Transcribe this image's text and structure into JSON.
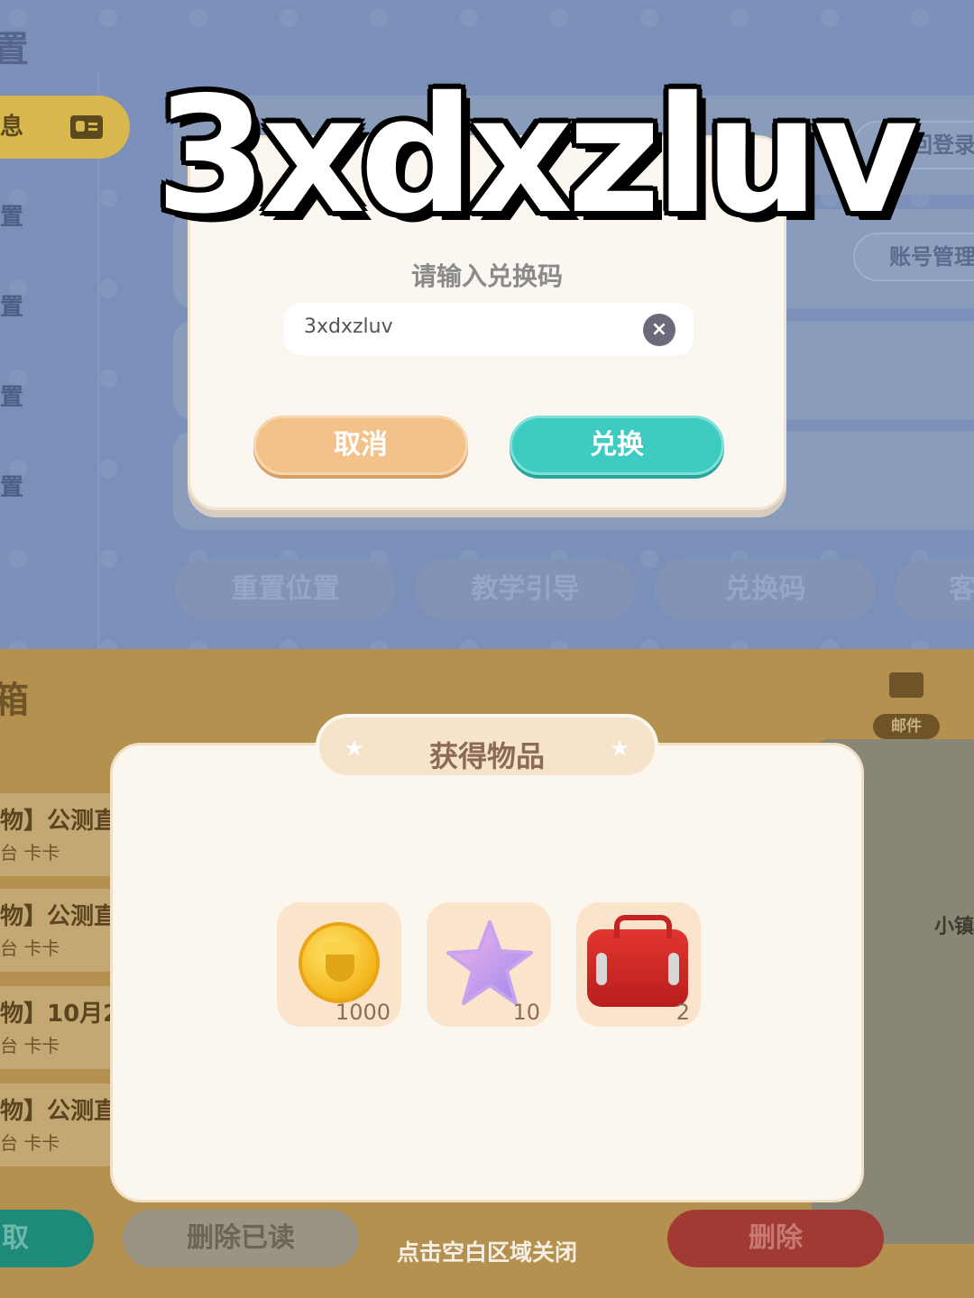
{
  "top_screen": {
    "title_fragment": "置",
    "sidebar": [
      {
        "label": "息",
        "active": true
      },
      {
        "label": "置"
      },
      {
        "label": "置"
      },
      {
        "label": "置"
      },
      {
        "label": "置"
      }
    ],
    "side_buttons": {
      "back_login": "返回登录",
      "account_manage": "账号管理"
    },
    "bottom_buttons": [
      {
        "label": "重置位置"
      },
      {
        "label": "教学引导"
      },
      {
        "label": "兑换码"
      },
      {
        "label": "客"
      }
    ]
  },
  "redeem_dialog": {
    "prompt": "请输入兑换码",
    "code_value": "3xdxzluv",
    "cancel_label": "取消",
    "exchange_label": "兑换"
  },
  "overlay_caption": "3xdxzluv",
  "mail_screen": {
    "title_fragment": "箱",
    "mail_label": "邮件",
    "items": [
      {
        "line1": "物】公测直",
        "line2": "台 卡卡"
      },
      {
        "line1": "物】公测直",
        "line2": "台 卡卡"
      },
      {
        "line1": "物】10月2",
        "line2": "台 卡卡"
      },
      {
        "line1": "物】公测直",
        "line2": "台 卡卡"
      }
    ],
    "right_fragment": "小镇",
    "claim_label": "取",
    "delete_read_label": "删除已读",
    "delete_label": "删除",
    "close_hint": "点击空白区域关闭"
  },
  "reward_dialog": {
    "title": "获得物品",
    "items": [
      {
        "icon": "acorn-coin-icon",
        "count": "1000"
      },
      {
        "icon": "star-icon",
        "count": "10"
      },
      {
        "icon": "red-toolbox-icon",
        "count": "2"
      }
    ]
  },
  "colors": {
    "cancel": "#f2c28a",
    "exchange": "#3ecbc1",
    "delete": "#a23a34",
    "claim": "#1e8a7a"
  }
}
